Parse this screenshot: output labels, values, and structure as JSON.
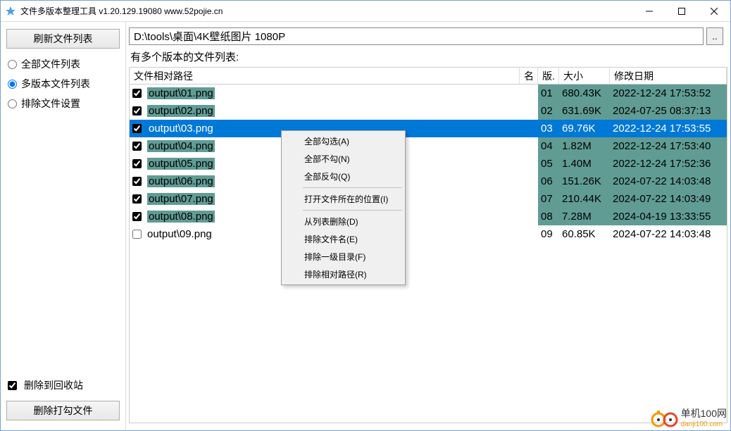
{
  "window": {
    "title": "文件多版本整理工具 v1.20.129.19080 www.52pojie.cn"
  },
  "sidebar": {
    "refresh_label": "刷新文件列表",
    "radios": [
      {
        "label": "全部文件列表",
        "checked": false
      },
      {
        "label": "多版本文件列表",
        "checked": true
      },
      {
        "label": "排除文件设置",
        "checked": false
      }
    ],
    "recycle_label": "删除到回收站",
    "recycle_checked": true,
    "delete_label": "删除打勾文件"
  },
  "main": {
    "path_value": "D:\\tools\\桌面\\4K壁纸图片 1080P",
    "browse_label": "..",
    "list_caption": "有多个版本的文件列表:",
    "columns": {
      "path": "文件相对路径",
      "name": "名",
      "ver": "版.",
      "size": "大小",
      "date": "修改日期"
    },
    "rows": [
      {
        "checked": true,
        "path": "output\\01.png",
        "ver": "01",
        "size": "680.43K",
        "date": "2022-12-24 17:53:52",
        "hl": true,
        "sel": false
      },
      {
        "checked": true,
        "path": "output\\02.png",
        "ver": "02",
        "size": "631.69K",
        "date": "2024-07-25 08:37:13",
        "hl": true,
        "sel": false
      },
      {
        "checked": true,
        "path": "output\\03.png",
        "ver": "03",
        "size": "69.76K",
        "date": "2022-12-24 17:53:55",
        "hl": true,
        "sel": true
      },
      {
        "checked": true,
        "path": "output\\04.png",
        "ver": "04",
        "size": "1.82M",
        "date": "2022-12-24 17:53:40",
        "hl": true,
        "sel": false
      },
      {
        "checked": true,
        "path": "output\\05.png",
        "ver": "05",
        "size": "1.40M",
        "date": "2022-12-24 17:52:36",
        "hl": true,
        "sel": false
      },
      {
        "checked": true,
        "path": "output\\06.png",
        "ver": "06",
        "size": "151.26K",
        "date": "2024-07-22 14:03:48",
        "hl": true,
        "sel": false
      },
      {
        "checked": true,
        "path": "output\\07.png",
        "ver": "07",
        "size": "210.44K",
        "date": "2024-07-22 14:03:49",
        "hl": true,
        "sel": false
      },
      {
        "checked": true,
        "path": "output\\08.png",
        "ver": "08",
        "size": "7.28M",
        "date": "2024-04-19 13:33:55",
        "hl": true,
        "sel": false
      },
      {
        "checked": false,
        "path": "output\\09.png",
        "ver": "09",
        "size": "60.85K",
        "date": "2024-07-22 14:03:48",
        "hl": false,
        "sel": false
      }
    ]
  },
  "context_menu": {
    "items": [
      {
        "label": "全部勾选(A)"
      },
      {
        "label": "全部不勾(N)"
      },
      {
        "label": "全部反勾(Q)"
      },
      {
        "sep": true
      },
      {
        "label": "打开文件所在的位置(I)"
      },
      {
        "sep": true
      },
      {
        "label": "从列表删除(D)"
      },
      {
        "label": "排除文件名(E)"
      },
      {
        "label": "排除一级目录(F)"
      },
      {
        "label": "排除相对路径(R)"
      }
    ]
  },
  "brand": {
    "name": "单机100网",
    "sub": "danji100.com"
  }
}
